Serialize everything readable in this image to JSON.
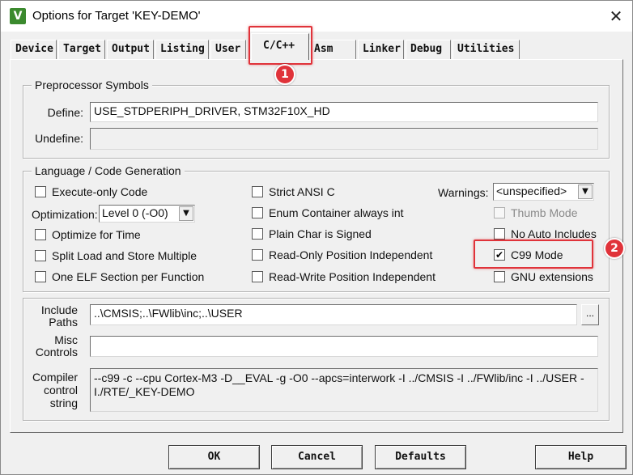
{
  "window": {
    "icon_glyph": "V",
    "title": "Options for Target 'KEY-DEMO'",
    "close_glyph": "✕"
  },
  "tabs": [
    {
      "label": "Device"
    },
    {
      "label": "Target"
    },
    {
      "label": "Output"
    },
    {
      "label": "Listing"
    },
    {
      "label": "User"
    },
    {
      "label": "C/C++",
      "active": true
    },
    {
      "label": "Asm"
    },
    {
      "label": "Linker"
    },
    {
      "label": "Debug"
    },
    {
      "label": "Utilities"
    }
  ],
  "preprocessor": {
    "group_label": "Preprocessor Symbols",
    "define_label": "Define:",
    "define_value": "USE_STDPERIPH_DRIVER, STM32F10X_HD",
    "undefine_label": "Undefine:",
    "undefine_value": ""
  },
  "language": {
    "group_label": "Language / Code Generation",
    "execute_only": {
      "label": "Execute-only Code",
      "checked": false
    },
    "optimization_label": "Optimization:",
    "optimization_value": "Level 0 (-O0)",
    "optimize_time": {
      "label": "Optimize for Time",
      "checked": false
    },
    "split_load": {
      "label": "Split Load and Store Multiple",
      "checked": false
    },
    "one_elf": {
      "label": "One ELF Section per Function",
      "checked": false
    },
    "strict_ansi": {
      "label": "Strict ANSI C",
      "checked": false
    },
    "enum_container": {
      "label": "Enum Container always int",
      "checked": false
    },
    "plain_char": {
      "label": "Plain Char is Signed",
      "checked": false
    },
    "ropi": {
      "label": "Read-Only Position Independent",
      "checked": false
    },
    "rwpi": {
      "label": "Read-Write Position Independent",
      "checked": false
    },
    "warnings_label": "Warnings:",
    "warnings_value": "<unspecified>",
    "thumb_mode": {
      "label": "Thumb Mode",
      "checked": false,
      "disabled": true
    },
    "no_auto_includes": {
      "label": "No Auto Includes",
      "checked": false
    },
    "c99_mode": {
      "label": "C99 Mode",
      "checked": true,
      "check_glyph": "✔"
    },
    "gnu_extensions": {
      "label": "GNU extensions",
      "checked": false
    }
  },
  "include_paths": {
    "label_line1": "Include",
    "label_line2": "Paths",
    "value": "..\\CMSIS;..\\FWlib\\inc;..\\USER",
    "browse_label": "..."
  },
  "misc_controls": {
    "label_line1": "Misc",
    "label_line2": "Controls",
    "value": ""
  },
  "compiler_string": {
    "label_line1": "Compiler",
    "label_line2": "control",
    "label_line3": "string",
    "value": "--c99 -c --cpu Cortex-M3 -D__EVAL -g -O0 --apcs=interwork -I ../CMSIS -I ../FWlib/inc -I ../USER -I./RTE/_KEY-DEMO"
  },
  "buttons": {
    "ok": "OK",
    "cancel": "Cancel",
    "defaults": "Defaults",
    "help": "Help"
  },
  "annotations": [
    {
      "number": "1"
    },
    {
      "number": "2"
    }
  ],
  "colors": {
    "highlight": "#e0333a",
    "dialog_bg": "#f0f0f0"
  }
}
